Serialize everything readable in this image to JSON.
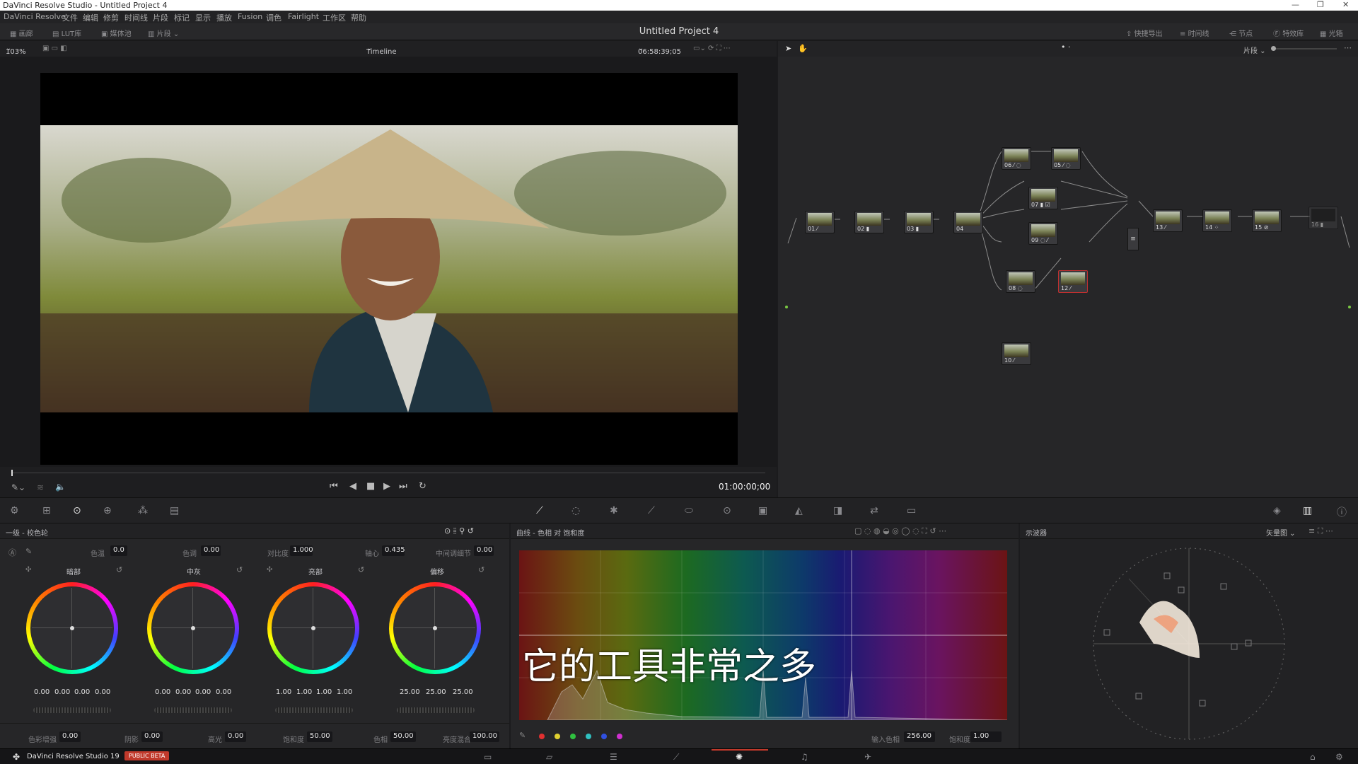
{
  "window": {
    "title": "DaVinci Resolve Studio - Untitled Project 4"
  },
  "menu": [
    "DaVinci Resolve",
    "文件",
    "编辑",
    "修剪",
    "时间线",
    "片段",
    "标记",
    "显示",
    "播放",
    "Fusion",
    "调色",
    "Fairlight",
    "工作区",
    "帮助"
  ],
  "toolbar": {
    "left": [
      {
        "label": "画廊",
        "icon": "gallery-icon"
      },
      {
        "label": "LUT库",
        "icon": "lut-icon"
      },
      {
        "label": "媒体池",
        "icon": "media-pool-icon"
      },
      {
        "label": "片段",
        "icon": "clips-icon"
      }
    ],
    "project_title": "Untitled Project 4",
    "right": [
      {
        "label": "快捷导出",
        "icon": "export-icon"
      },
      {
        "label": "时间线",
        "icon": "timeline-icon"
      },
      {
        "label": "节点",
        "icon": "nodes-icon"
      },
      {
        "label": "特效库",
        "icon": "effects-icon"
      },
      {
        "label": "光箱",
        "icon": "lightbox-icon"
      }
    ]
  },
  "viewer": {
    "zoom": "103%",
    "timeline_name": "Timeline 1",
    "source_timecode": "06:58:39;05",
    "timecode": "01:00:00;00"
  },
  "nodes_header": {
    "mode": "片段"
  },
  "nodes": [
    {
      "label": "01 ⁄"
    },
    {
      "label": "02 ▮"
    },
    {
      "label": "03 ▮"
    },
    {
      "label": "04"
    },
    {
      "label": "06 ⁄ ◌"
    },
    {
      "label": "05 ⁄ ◌"
    },
    {
      "label": "07 ▮ ☑"
    },
    {
      "label": "09 ◌ ⁄"
    },
    {
      "label": "08 ◌"
    },
    {
      "label": "12 ⁄"
    },
    {
      "label": "10 ⁄"
    },
    {
      "label": "13 ⁄"
    },
    {
      "label": "14 ⁘"
    },
    {
      "label": "15 ⊘"
    },
    {
      "label": "16 ▮"
    }
  ],
  "primary": {
    "title": "一级 - 校色轮",
    "params": [
      {
        "label": "色温",
        "value": "0.0"
      },
      {
        "label": "色调",
        "value": "0.00"
      },
      {
        "label": "对比度",
        "value": "1.000"
      },
      {
        "label": "轴心",
        "value": "0.435"
      },
      {
        "label": "中间调细节",
        "value": "0.00"
      }
    ],
    "wheels": [
      {
        "name": "暗部",
        "values": [
          "0.00",
          "0.00",
          "0.00",
          "0.00"
        ]
      },
      {
        "name": "中灰",
        "values": [
          "0.00",
          "0.00",
          "0.00",
          "0.00"
        ]
      },
      {
        "name": "亮部",
        "values": [
          "1.00",
          "1.00",
          "1.00",
          "1.00"
        ]
      },
      {
        "name": "偏移",
        "values": [
          "25.00",
          "25.00",
          "25.00"
        ]
      }
    ],
    "bottom": [
      {
        "label": "色彩增强",
        "value": "0.00"
      },
      {
        "label": "阴影",
        "value": "0.00"
      },
      {
        "label": "高光",
        "value": "0.00"
      },
      {
        "label": "饱和度",
        "value": "50.00"
      },
      {
        "label": "色相",
        "value": "50.00"
      },
      {
        "label": "亮度混合",
        "value": "100.00"
      }
    ]
  },
  "curves": {
    "title": "曲线 - 色相 对 饱和度",
    "subtitle_overlay": "它的工具非常之多",
    "swatches": [
      "#e03030",
      "#e0d030",
      "#30c040",
      "#30c0c0",
      "#3050e0",
      "#d030d0"
    ],
    "input_label": "输入色相",
    "input_value": "256.00",
    "sat_label": "饱和度",
    "sat_value": "1.00"
  },
  "scope": {
    "title": "示波器",
    "mode": "矢量图"
  },
  "footer": {
    "app": "DaVinci Resolve Studio 19",
    "badge": "PUBLIC BETA"
  }
}
